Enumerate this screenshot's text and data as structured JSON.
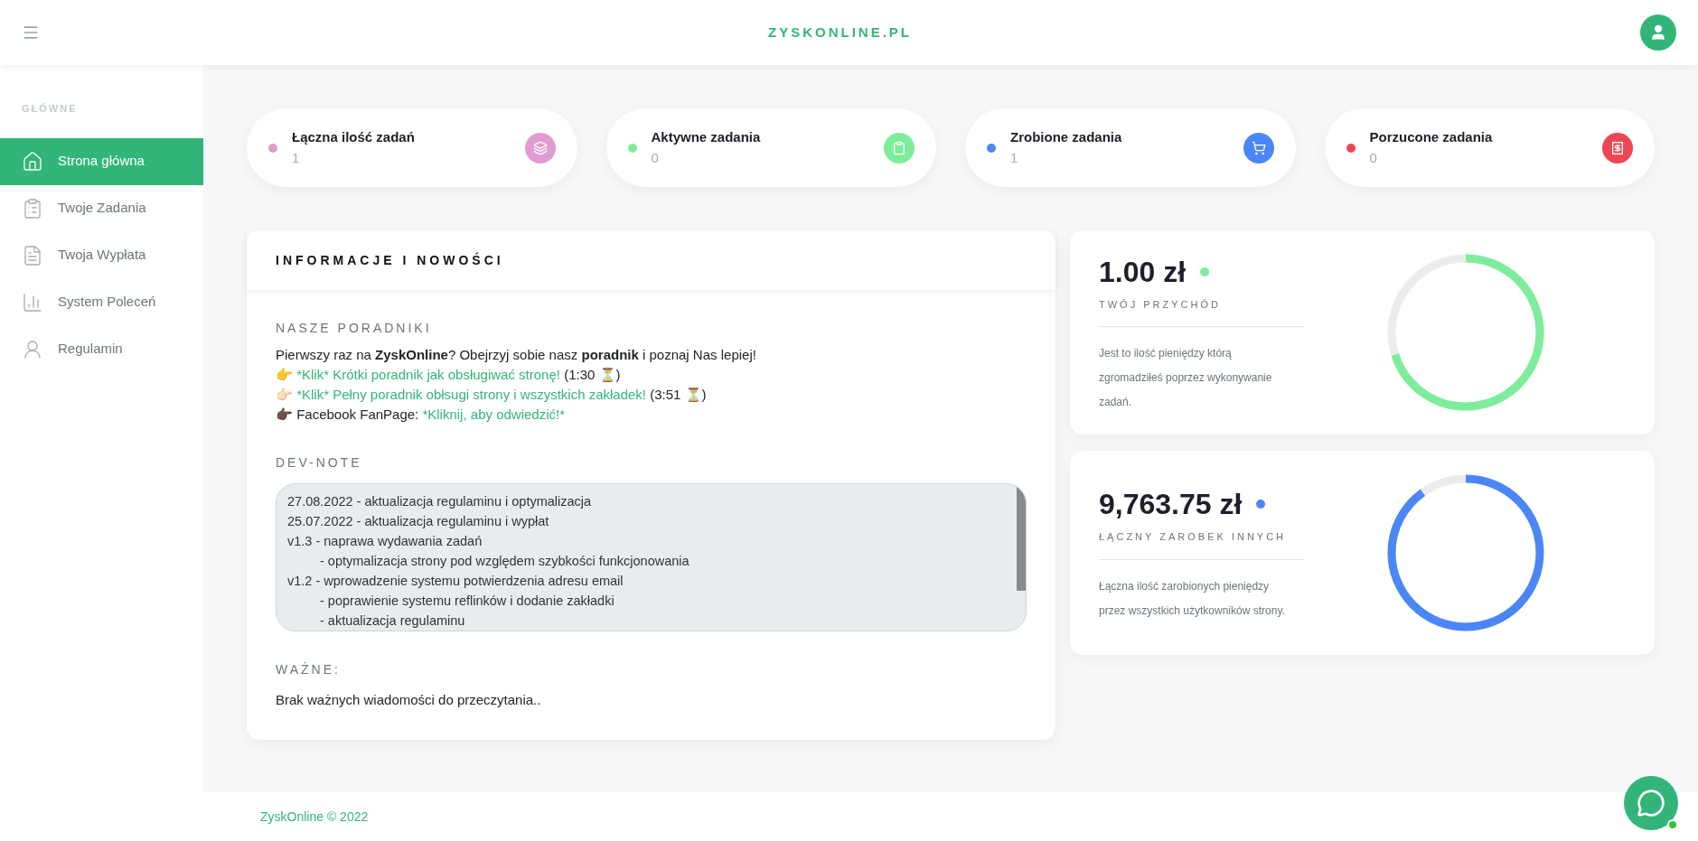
{
  "header": {
    "brand": "ZYSKONLINE.PL"
  },
  "sidebar": {
    "section": "GŁÓWNE",
    "items": [
      {
        "label": "Strona główna",
        "kind": "home",
        "selected": true
      },
      {
        "label": "Twoje Zadania",
        "kind": "tasks",
        "selected": false
      },
      {
        "label": "Twoja Wypłata",
        "kind": "payout",
        "selected": false
      },
      {
        "label": "System Poleceń",
        "kind": "referrals",
        "selected": false
      },
      {
        "label": "Regulamin",
        "kind": "rules",
        "selected": false
      }
    ]
  },
  "stats": [
    {
      "label": "Łączna ilość zadań",
      "value": "1",
      "color": "#e09ccf",
      "kind": "total"
    },
    {
      "label": "Aktywne zadania",
      "value": "0",
      "color": "#7ded9b",
      "kind": "active"
    },
    {
      "label": "Zrobione zadania",
      "value": "1",
      "color": "#4b86f9",
      "kind": "done"
    },
    {
      "label": "Porzucone zadania",
      "value": "0",
      "color": "#ec4652",
      "kind": "abandoned"
    }
  ],
  "info": {
    "title": "INFORMACJE I NOWOŚCI",
    "guides_heading": "NASZE PORADNIKI",
    "intro": "Pierwszy raz na **ZyskOnline**? Obejrzyj sobie nasz **poradnik** i poznaj Nas lepiej!",
    "guides": [
      {
        "emoji": "👉",
        "link": "*Klik* Krótki poradnik jak obsługiwać stronę!",
        "suffix": "(1:30 ⏳)"
      },
      {
        "emoji": "👉🏻",
        "link": "*Klik* Pełny poradnik obłsugi strony i wszystkich zakładek!",
        "suffix": "(3:51 ⏳)"
      },
      {
        "emoji": "👉🏿",
        "prefix": "Facebook FanPage:",
        "link": "*Kliknij, aby odwiedzić!*"
      }
    ],
    "devnote_heading": "DEV-NOTE",
    "devnotes": [
      {
        "text": "27.08.2022 - aktualizacja regulaminu i optymalizacja"
      },
      {
        "text": "25.07.2022 - aktualizacja regulaminu i wypłat"
      },
      {
        "text": "v1.3 - naprawa wydawania zadań",
        "children": [
          {
            "text": "- optymalizacja strony pod względem szybkości funkcjonowania"
          }
        ]
      },
      {
        "text": "v1.2 - wprowadzenie systemu potwierdzenia adresu email",
        "children": [
          {
            "text": "- poprawienie systemu reflinków i dodanie zakładki"
          },
          {
            "text": "- aktualizacja regulaminu"
          }
        ]
      }
    ],
    "important_heading": "WAŻNE:",
    "important_text": "Brak ważnych wiadomości do przeczytania.."
  },
  "earnings": [
    {
      "amount": "1.00 zł",
      "label": "TWÓJ PRZYCHÓD",
      "description": "Jest to ilość pieniędzy którą zgromadziłeś poprzez wykonywanie zadań.",
      "color": "#7ded9b",
      "level": 0.7
    },
    {
      "amount": "9,763.75 zł",
      "label": "ŁĄCZNY ZAROBEK INNYCH",
      "description": "Łączna ilość zarobionych pieniędzy przez wszystkich użytkowników strony.",
      "color": "#4b86f9",
      "level": 0.9
    }
  ],
  "footer": {
    "text": "ZyskOnline © 2022"
  }
}
